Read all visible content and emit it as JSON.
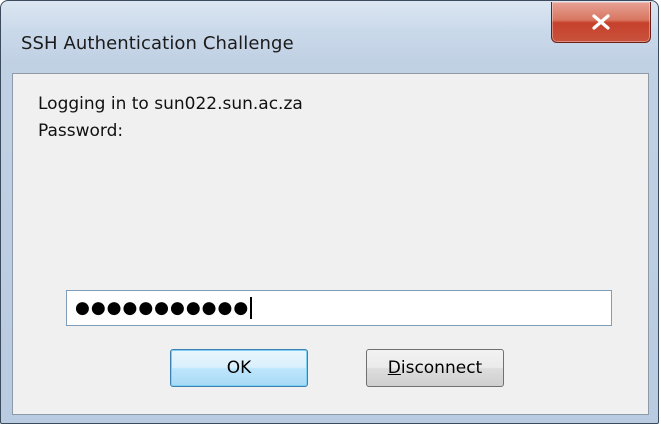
{
  "window": {
    "title": "SSH Authentication Challenge",
    "close_icon": "close-x-icon"
  },
  "message": {
    "line1": "Logging in to sun022.sun.ac.za",
    "line2": "Password:"
  },
  "password_field": {
    "value": "●●●●●●●●●●●"
  },
  "buttons": {
    "ok_label": "OK",
    "disconnect_accel": "D",
    "disconnect_rest": "isconnect"
  },
  "colors": {
    "close_button": "#c6412c",
    "ok_button_border": "#3c7fb1"
  }
}
